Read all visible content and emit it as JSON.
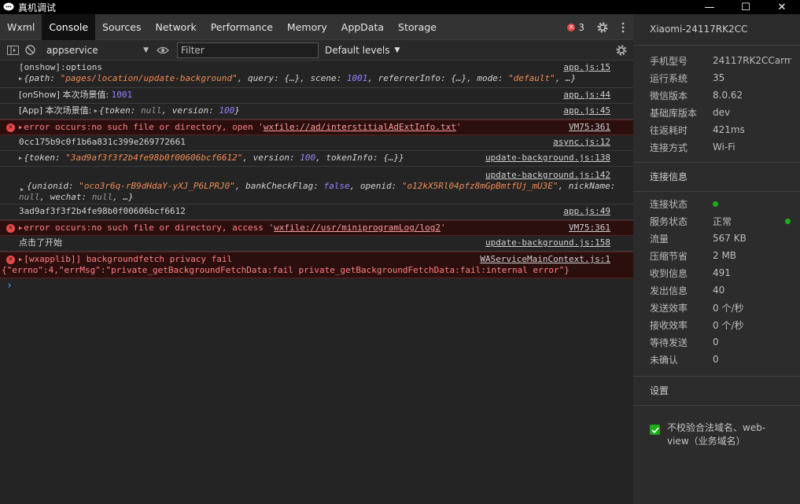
{
  "window": {
    "title": "真机调试",
    "controls": {
      "minimize": "—",
      "maximize": "☐",
      "close": "✕"
    }
  },
  "tabs": [
    {
      "label": "Wxml",
      "active": false
    },
    {
      "label": "Console",
      "active": true
    },
    {
      "label": "Sources",
      "active": false
    },
    {
      "label": "Network",
      "active": false
    },
    {
      "label": "Performance",
      "active": false
    },
    {
      "label": "Memory",
      "active": false
    },
    {
      "label": "AppData",
      "active": false
    },
    {
      "label": "Storage",
      "active": false
    }
  ],
  "error_count": "3",
  "toolbar": {
    "context": "appservice",
    "filter_placeholder": "Filter",
    "levels": "Default levels"
  },
  "console": {
    "r1": {
      "line1": "[onshow]:options",
      "src": "app.js:15"
    },
    "r1b": {
      "open": "{",
      "k1": "path: ",
      "v1": "\"pages/location/update-background\"",
      "k2": ", query: {…}, scene: ",
      "v2": "1001",
      "k3": ", referrerInfo: {…}, mode: ",
      "v3": "\"default\"",
      "end": ", …}"
    },
    "r2": {
      "text": "[onShow] 本次场景值: ",
      "num": "1001",
      "src": "app.js:44"
    },
    "r3": {
      "text": "[App] 本次场景值: ",
      "k1": "{token: ",
      "v1": "null",
      "k2": ", version: ",
      "v2": "100",
      "end": "}",
      "src": "app.js:45"
    },
    "r4": {
      "text": "error occurs:no such file or directory, open '",
      "link": "wxfile://ad/interstitialAdExtInfo.txt",
      "end": "'",
      "src": "VM75:361"
    },
    "r5": {
      "text": "0cc175b9c0f1b6a831c399e269772661",
      "src": "async.js:12"
    },
    "r6": {
      "k1": "{token: ",
      "v1": "\"3ad9af3f3f2b4fe98b0f00606bcf6612\"",
      "k2": ", version: ",
      "v2": "100",
      "k3": ", tokenInfo: {…}}",
      "src": "update-background.js:138"
    },
    "r7": {
      "src": "update-background.js:142",
      "k1": "{unionid: ",
      "v1": "\"oco3r6q-rB9dHdaY-yXJ_P6LPRJ0\"",
      "k2": ", bankCheckFlag: ",
      "v2": "false",
      "k3": ", openid: ",
      "v3": "\"o12kX5Rl04pfz8mGpBmtfUj_mU3E\"",
      "k4": ", nickName:",
      "k5": "null",
      "k6": ", wechat: ",
      "k7": "null",
      "k8": ", …}"
    },
    "r8": {
      "text": "3ad9af3f3f2b4fe98b0f00606bcf6612",
      "src": "app.js:49"
    },
    "r9": {
      "text": "error occurs:no such file or directory, access '",
      "link": "wxfile://usr/miniprogramLog/log2",
      "end": "'",
      "src": "VM75:361"
    },
    "r10": {
      "text": "点击了开始",
      "src": "update-background.js:158"
    },
    "r11": {
      "line1": "[wxapplib]] backgroundfetch privacy fail",
      "line2": "{\"errno\":4,\"errMsg\":\"private_getBackgroundFetchData:fail private_getBackgroundFetchData:fail:internal error\"}",
      "src": "WAServiceMainContext.js:1"
    },
    "prompt": "›"
  },
  "side": {
    "device": "Xiaomi-24117RK2CC",
    "info": [
      {
        "k": "手机型号",
        "v": "24117RK2CCarm…"
      },
      {
        "k": "运行系统",
        "v": "35"
      },
      {
        "k": "微信版本",
        "v": "8.0.62"
      },
      {
        "k": "基础库版本",
        "v": "dev"
      },
      {
        "k": "往返耗时",
        "v": "421ms"
      },
      {
        "k": "连接方式",
        "v": "Wi-Fi"
      }
    ],
    "conn_title": "连接信息",
    "conn": [
      {
        "k": "连接状态",
        "v": ""
      },
      {
        "k": "服务状态",
        "v": "正常"
      },
      {
        "k": "流量",
        "v": "567 KB"
      },
      {
        "k": "压缩节省",
        "v": "2 MB"
      },
      {
        "k": "收到信息",
        "v": "491"
      },
      {
        "k": "发出信息",
        "v": "40"
      },
      {
        "k": "发送效率",
        "v": "0 个/秒"
      },
      {
        "k": "接收效率",
        "v": "0 个/秒"
      },
      {
        "k": "等待发送",
        "v": "0"
      },
      {
        "k": "未确认",
        "v": "0"
      }
    ],
    "settings_title": "设置",
    "checkbox_label": "不校验合法域名、web-view（业务域名）",
    "accent": "#1aad19"
  }
}
